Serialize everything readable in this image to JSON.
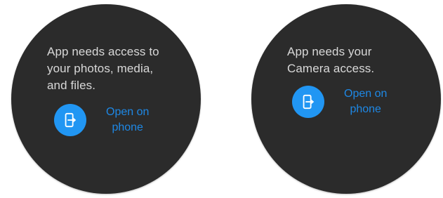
{
  "screens": [
    {
      "message": "App needs access to\nyour photos, media,\nand files.",
      "action": {
        "icon": "open-on-phone-icon",
        "label": "Open on\nphone"
      }
    },
    {
      "message": "App needs your\nCamera access.",
      "action": {
        "icon": "open-on-phone-icon",
        "label": "Open on\nphone"
      }
    }
  ],
  "colors": {
    "watch_background": "#2b2b2b",
    "text": "#d8d8d8",
    "accent": "#2196f3",
    "action_text": "#1e88e5"
  }
}
